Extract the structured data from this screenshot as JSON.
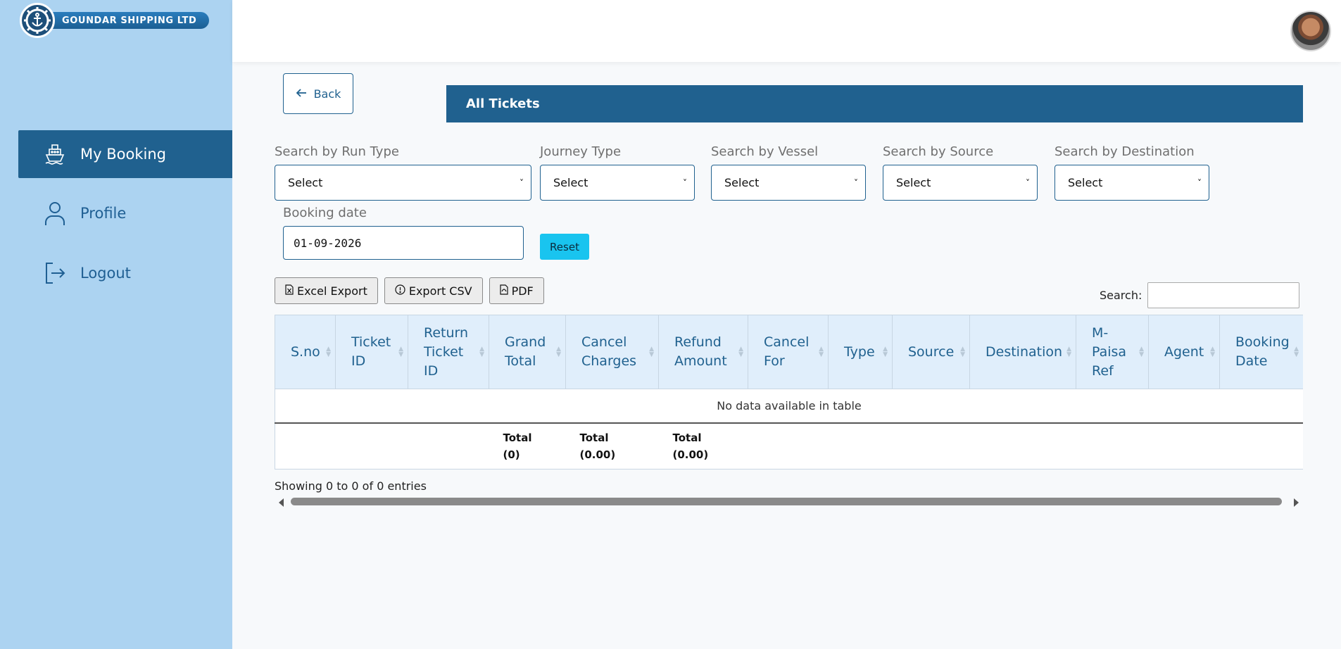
{
  "brand": {
    "name": "GOUNDAR SHIPPING LTD"
  },
  "sidebar": {
    "items": [
      {
        "label": "My Booking",
        "icon": "ship-icon",
        "active": true
      },
      {
        "label": "Profile",
        "icon": "user-icon",
        "active": false
      },
      {
        "label": "Logout",
        "icon": "logout-icon",
        "active": false
      }
    ]
  },
  "header": {
    "avatar": "user-avatar"
  },
  "main": {
    "back_label": "Back",
    "title": "All Tickets",
    "filters": [
      {
        "label": "Search by Run Type",
        "value": "Select"
      },
      {
        "label": "Journey Type",
        "value": "Select"
      },
      {
        "label": "Search by Vessel",
        "value": "Select"
      },
      {
        "label": "Search by Source",
        "value": "Select"
      },
      {
        "label": "Search by Destination",
        "value": "Select"
      }
    ],
    "booking_date": {
      "label": "Booking date",
      "value": "01-09-2026"
    },
    "reset_label": "Reset",
    "export": {
      "excel_label": "Excel Export",
      "csv_label": "Export CSV",
      "pdf_label": "PDF"
    },
    "search_label": "Search:",
    "table": {
      "columns": [
        "S.no",
        "Ticket ID",
        "Return Ticket ID",
        "Grand Total",
        "Cancel Charges",
        "Refund Amount",
        "Cancel For",
        "Type",
        "Source",
        "Destination",
        "M-Paisa Ref",
        "Agent",
        "Booking Date"
      ],
      "empty_message": "No data available in table",
      "totals": [
        "Total (0)",
        "Total (0.00)",
        "Total (0.00)"
      ]
    },
    "showing_text": "Showing 0 to 0 of 0 entries"
  }
}
